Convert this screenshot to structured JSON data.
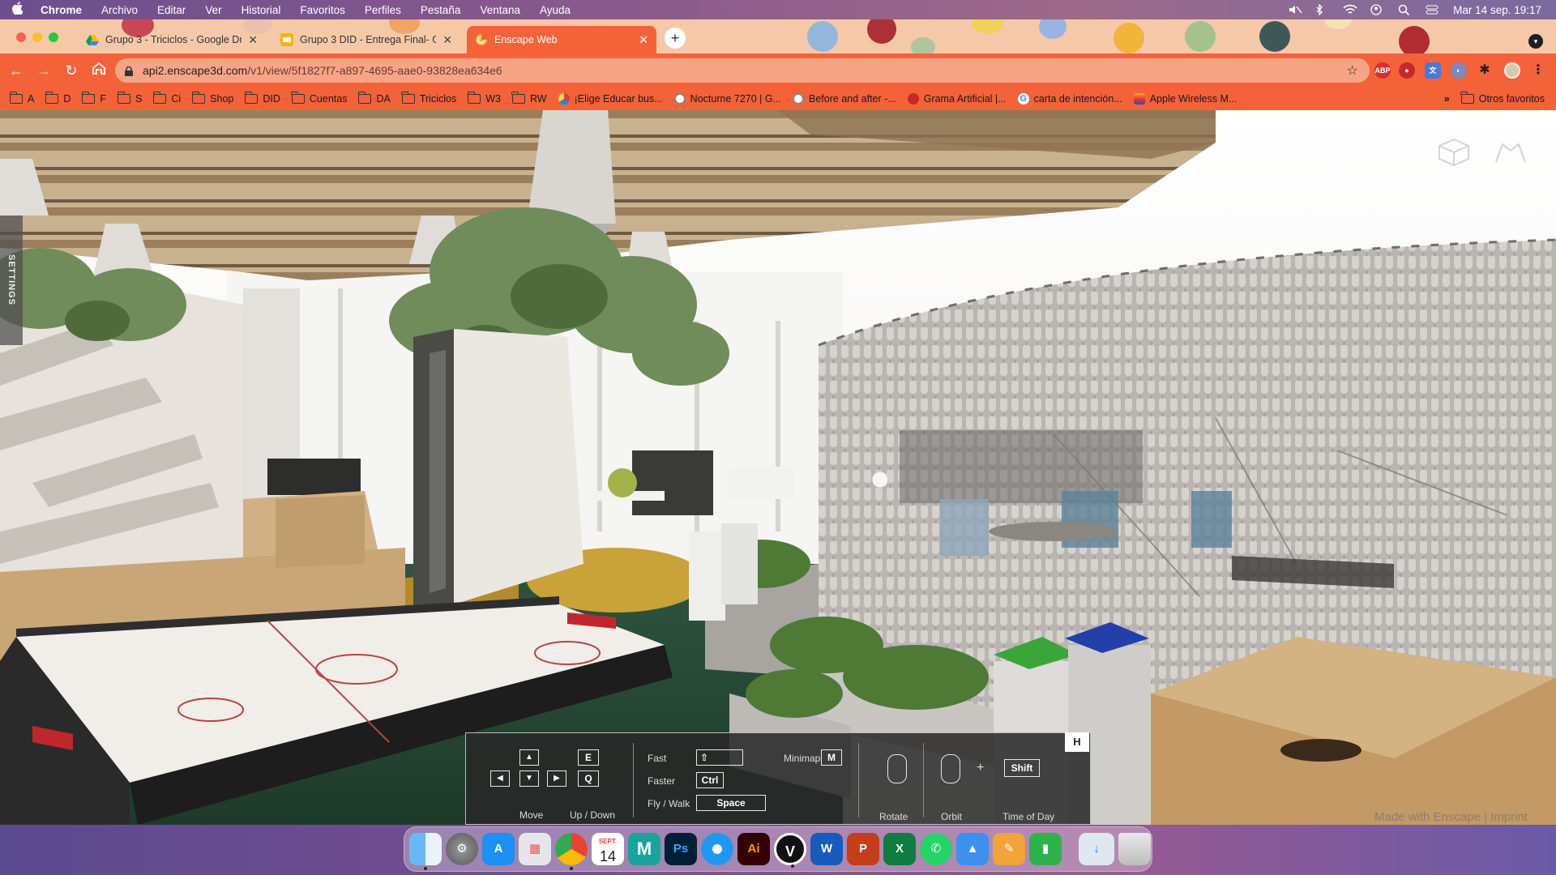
{
  "menubar": {
    "app_name": "Chrome",
    "items": [
      "Archivo",
      "Editar",
      "Ver",
      "Historial",
      "Favoritos",
      "Perfiles",
      "Pestaña",
      "Ventana",
      "Ayuda"
    ],
    "clock": "Mar 14 sep.  19:17"
  },
  "tabs": [
    {
      "label": "Grupo 3 - Triciclos - Google Dr",
      "icon": "google-drive-icon",
      "active": false
    },
    {
      "label": "Grupo 3 DID - Entrega Final- G",
      "icon": "google-slides-icon",
      "active": false
    },
    {
      "label": "Enscape Web",
      "icon": "enscape-icon",
      "active": true
    }
  ],
  "toolbar": {
    "url_host": "api2.enscape3d.com",
    "url_path": "/v1/view/5f1827f7-a897-4695-aae0-93828ea634e6",
    "extensions": [
      "ABP",
      "adblock-icon",
      "google-translate-icon",
      "extension-icon",
      "puzzle-icon",
      "profile-avatar-icon",
      "more-icon"
    ]
  },
  "bookmarks": {
    "folders": [
      "A",
      "D",
      "F",
      "S",
      "Ci",
      "Shop",
      "DID",
      "Cuentas",
      "DA",
      "Triciclos",
      "W3",
      "RW"
    ],
    "links": [
      "¡Elige Educar bus...",
      "Nocturne 7270 | G...",
      "Before and after -...",
      "Grama Artificial |...",
      "carta de intención...",
      "Apple Wireless M..."
    ],
    "more": "»",
    "other": "Otros favoritos"
  },
  "viewer": {
    "settings_label": "SETTINGS",
    "watermark": "Made with Enscape | Imprint"
  },
  "controls": {
    "move_label": "Move",
    "updown_label": "Up / Down",
    "key_e": "E",
    "key_q": "Q",
    "fast_label": "Fast",
    "faster_label": "Faster",
    "flywalk_label": "Fly  /  Walk",
    "key_ctrl": "Ctrl",
    "key_space": "Space",
    "minimap_label": "Minimap",
    "key_m": "M",
    "rotate_label": "Rotate",
    "orbit_label": "Orbit",
    "plus": "+",
    "key_shift": "Shift",
    "timeofday_label": "Time of Day",
    "hide_key": "H"
  },
  "dock": {
    "calendar_month": "SEPT.",
    "calendar_day": "14",
    "apps": [
      "Finder",
      "System Preferences",
      "App Store",
      "Launchpad",
      "Chrome",
      "Calendar",
      "Maya",
      "Photoshop",
      "Safari",
      "Illustrator",
      "Vectorworks",
      "Word",
      "PowerPoint",
      "Excel",
      "WhatsApp",
      "Keynote",
      "Pages",
      "Numbers",
      "Downloads",
      "Trash"
    ]
  },
  "colors": {
    "chrome_accent": "#f4623a",
    "tab_strip": "#f5c9a8",
    "omnibox": "#f7a486"
  }
}
